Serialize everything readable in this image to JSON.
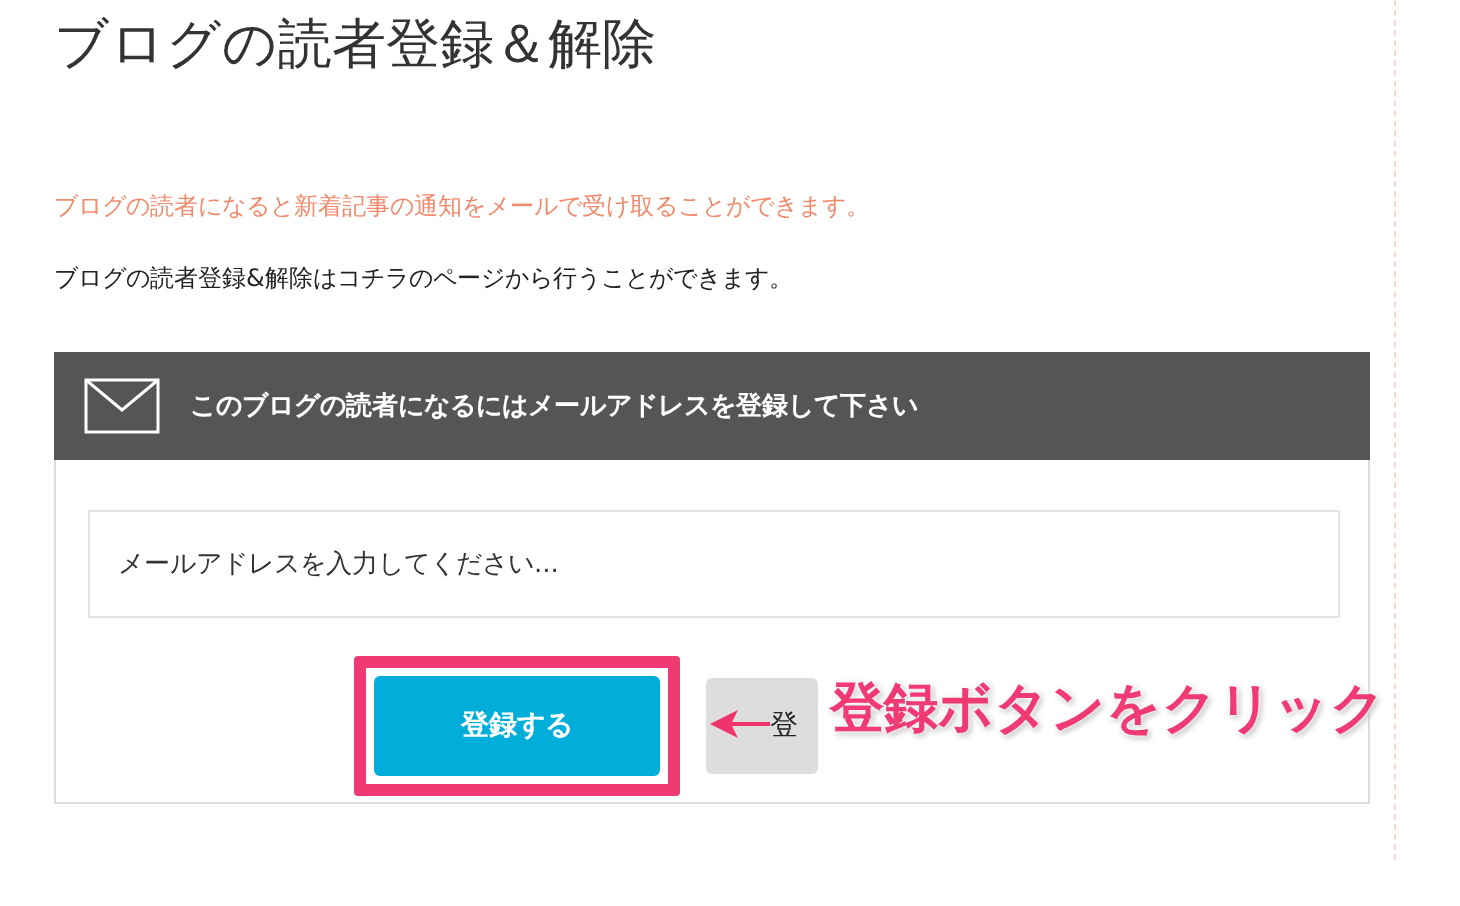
{
  "page": {
    "title": "ブログの読者登録＆解除"
  },
  "notice": "ブログの読者になると新着記事の通知をメールで受け取ることができます。",
  "description": "ブログの読者登録&解除はコチラのページから行うことができます。",
  "subscribe_form": {
    "header": "このブログの読者になるにはメールアドレスを登録して下さい",
    "email": {
      "placeholder": "メールアドレスを入力してください..."
    },
    "buttons": [
      {
        "label": "登録する",
        "kind": "primary",
        "highlighted": true
      },
      {
        "label": "登",
        "kind": "secondary",
        "highlighted": false
      }
    ]
  },
  "annotation": {
    "text": "登録ボタンをクリック"
  }
}
